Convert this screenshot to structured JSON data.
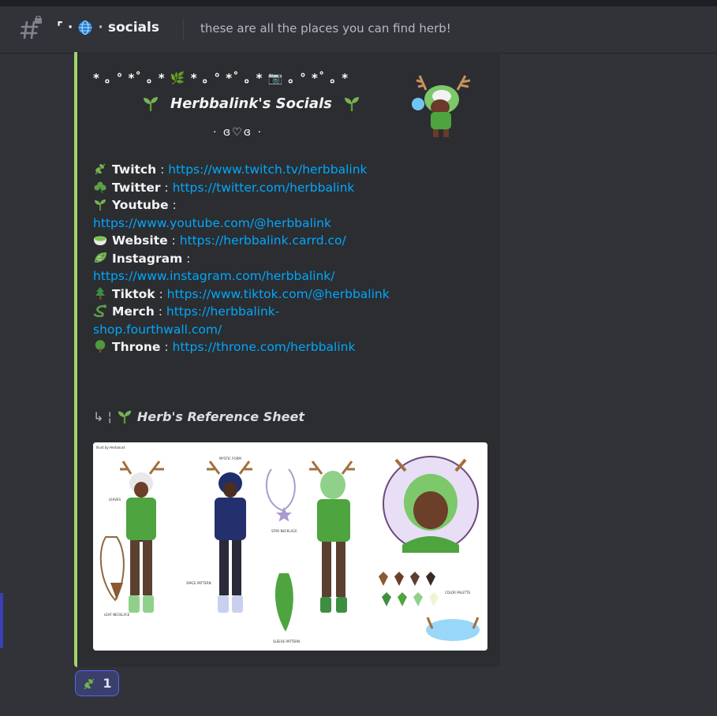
{
  "header": {
    "channel_prefix": "⌜ ·",
    "globe_icon": "globe-icon",
    "channel_sep": "·",
    "channel_name": "socials",
    "topic": "these are all the places you can find herb!"
  },
  "embed": {
    "accent_color": "#a3d46a",
    "decoration_line": "* ｡ ° *˚ ｡ *  🌿  * ｡ ° *˚ ｡ *  📷  ｡ ° *˚ ｡ *",
    "title": "Herbbalink's Socials",
    "subtitle": "· ɞ♡ɞ ·",
    "links": [
      {
        "icon": "herb-icon",
        "label": "Twitch",
        "sep": " : ",
        "url": "https://www.twitch.tv/herbbalink"
      },
      {
        "icon": "shamrock-icon",
        "label": "Twitter",
        "sep": " : ",
        "url": "https://twitter.com/herbbalink"
      },
      {
        "icon": "seedling-icon",
        "label": "Youtube",
        "sep": " : ",
        "url": "https://www.youtube.com/@herbbalink"
      },
      {
        "icon": "matcha-icon",
        "label": "Website",
        "sep": " : ",
        "url": "https://herbbalink.carrd.co/"
      },
      {
        "icon": "leaf-wind-icon",
        "label": "Instagram",
        "sep": " : ",
        "url": "https://www.instagram.com/herbbalink/"
      },
      {
        "icon": "evergreen-tree-icon",
        "label": "Tiktok",
        "sep": " : ",
        "url": "https://www.tiktok.com/@herbbalink"
      },
      {
        "icon": "lizard-icon",
        "label": "Merch",
        "sep": " : ",
        "url": "https://herbbalink-shop.fourthwall.com/"
      },
      {
        "icon": "tree-icon",
        "label": "Throne",
        "sep": " : ",
        "url": "https://throne.com/herbbalink"
      }
    ],
    "ref_prefix": "↳ ¦",
    "ref_title": "Herb's Reference Sheet",
    "sheet_labels": {
      "credit": "Illust by Herbalust",
      "leaves": "LEAVES",
      "mystic": "MYSTIC FORM",
      "star": "STAR NECKLACE",
      "space": "SPACE PATTERN",
      "leaf_necklace": "LEAF NECKLACE",
      "sleeve": "SLEEVE PATTERN",
      "palette": "COLOR PALETTE"
    }
  },
  "reaction": {
    "icon": "herb-icon",
    "count": "1"
  },
  "colors": {
    "link": "#00a8fc",
    "bg": "#313338",
    "embed_bg": "#2b2d31"
  }
}
